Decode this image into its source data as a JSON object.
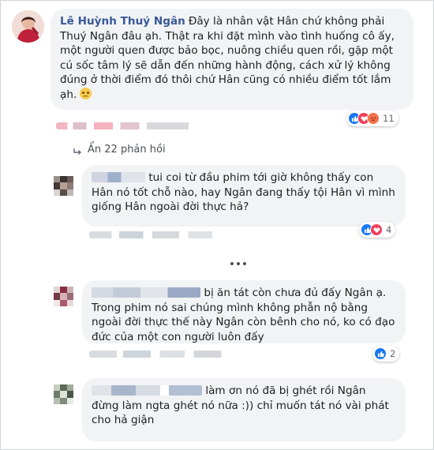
{
  "main_comment": {
    "author": "Lê Huỳnh Thuý Ngân",
    "text": "Đây là nhân vật Hân chứ không phải Thuý Ngân đâu ạh. Thật ra khi đặt mình vào tình huống cô ấy, một người quen được bảo bọc, nuông chiều quen rồi, gặp một cú sốc tâm lý sẽ dẫn đến những hành động, cách xử lý không đúng ở thời điểm đó thôi chứ Hân cũng có nhiều điểm tốt lắm ạh.",
    "emoji": "sad-face",
    "reaction_icons": [
      "like",
      "love",
      "angry"
    ],
    "reaction_count": "11"
  },
  "replies_link": {
    "label": "Ẩn 22 phản hồi"
  },
  "replies": [
    {
      "text": "tui coi từ đầu phim tới giờ không thấy con Hân nó tốt chỗ nào, hay Ngân đang thấy tội Hân vì mình giống Hân ngoài đời thực hả?",
      "reaction_icons": [
        "like",
        "love"
      ],
      "reaction_count": "4"
    },
    {
      "text": "bị ăn tát còn chưa đủ đấy Ngân ạ. Trong phim nó sai chúng mình không phẫn nộ bằng ngoài đời thực thế này Ngân còn bênh cho nó, ko có đạo đức của một con người luôn đấy",
      "reaction_icons": [
        "like"
      ],
      "reaction_count": "2"
    },
    {
      "text": "làm ơn nó đã bị ghét rồi Ngân đừng làm ngta ghét nó nữa :)) chỉ muốn tát nó vài phát cho hả giận",
      "reaction_icons": [],
      "reaction_count": ""
    }
  ],
  "colors": {
    "author_link": "#385898",
    "bubble_bg": "#f2f3f5",
    "like_blue": "#1877f2",
    "love_red": "#f33e58"
  }
}
